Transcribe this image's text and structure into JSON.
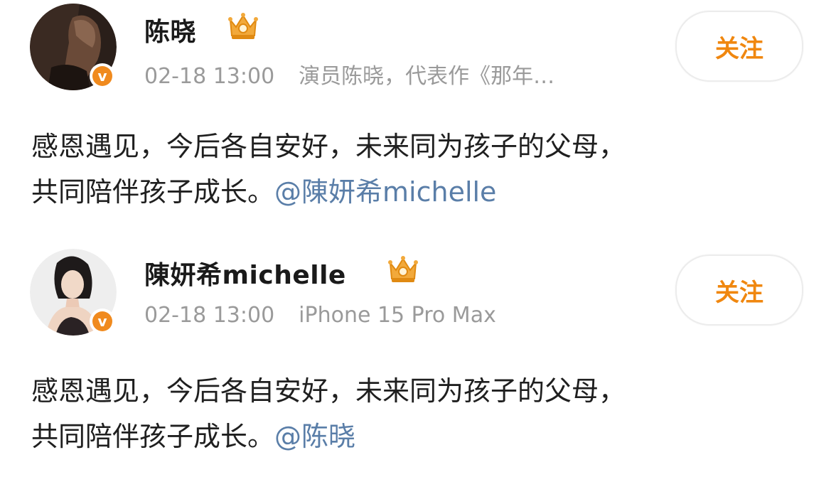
{
  "posts": [
    {
      "author": "陈晓",
      "time": "02-18 13:00",
      "source": "演员陈晓，代表作《那年…",
      "follow_label": "关注",
      "text_line1": "感恩遇见，今后各自安好，未来同为孩子的父母，",
      "text_line2": "共同陪伴孩子成长。",
      "mention": "@陳妍希michelle",
      "avatar_icon": "avatar-man",
      "badge_icon": "verified-v-icon",
      "crown_icon": "crown-icon"
    },
    {
      "author": "陳妍希michelle",
      "time": "02-18 13:00",
      "source": "iPhone 15 Pro Max",
      "follow_label": "关注",
      "text_line1": "感恩遇见，今后各自安好，未来同为孩子的父母，",
      "text_line2": "共同陪伴孩子成长。",
      "mention": "@陈晓",
      "avatar_icon": "avatar-woman",
      "badge_icon": "verified-v-icon",
      "crown_icon": "crown-icon"
    }
  ],
  "colors": {
    "follow_text": "#f0870f",
    "mention": "#5a7ea8",
    "badge": "#f08a1e",
    "meta": "#9a9a9a"
  },
  "badge_letter": "v"
}
